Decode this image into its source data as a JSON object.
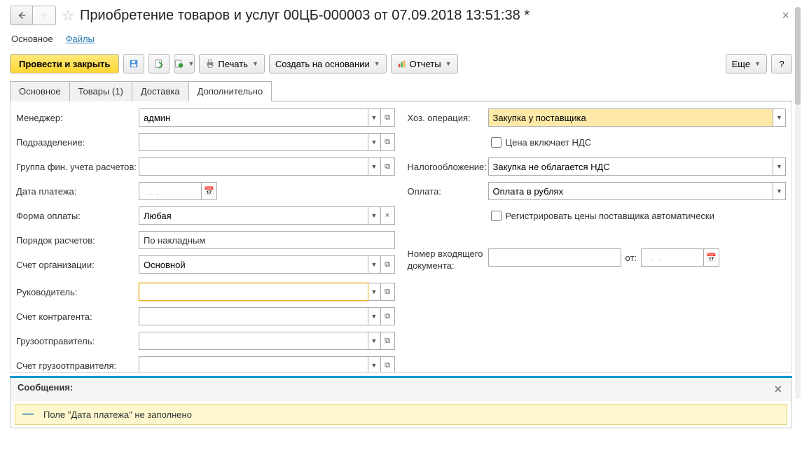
{
  "title": "Приобретение товаров и услуг 00ЦБ-000003 от 07.09.2018 13:51:38 *",
  "topnav": {
    "main": "Основное",
    "files": "Файлы"
  },
  "toolbar": {
    "post_close": "Провести и закрыть",
    "print": "Печать",
    "create_based_on": "Создать на основании",
    "reports": "Отчеты",
    "more": "Еще",
    "help": "?"
  },
  "tabs": {
    "main": "Основное",
    "goods": "Товары (1)",
    "delivery": "Доставка",
    "additional": "Дополнительно"
  },
  "labels": {
    "manager": "Менеджер:",
    "department": "Подразделение:",
    "fin_group": "Группа фин. учета расчетов:",
    "payment_date": "Дата платежа:",
    "payment_form": "Форма оплаты:",
    "settlement_order": "Порядок расчетов:",
    "org_account": "Счет организации:",
    "head": "Руководитель:",
    "counterparty_account": "Счет контрагента:",
    "shipper": "Грузоотправитель:",
    "shipper_account": "Счет грузоотправителя:",
    "business_op": "Хоз. операция:",
    "vat_included": "Цена включает НДС",
    "taxation": "Налогообложение:",
    "payment": "Оплата:",
    "register_prices": "Регистрировать цены поставщика автоматически",
    "incoming_doc": "Номер входящего документа:",
    "from": "от:"
  },
  "values": {
    "manager": "админ",
    "department": "",
    "fin_group": "",
    "payment_date": "  .  .    ",
    "payment_form": "Любая",
    "settlement_order": "По накладным",
    "org_account": "Основной",
    "head": "",
    "counterparty_account": "",
    "shipper": "",
    "shipper_account": "",
    "business_op": "Закупка у поставщика",
    "taxation": "Закупка не облагается НДС",
    "payment": "Оплата в рублях",
    "incoming_doc_no": "",
    "incoming_doc_date": "  .  .    "
  },
  "messages": {
    "header": "Сообщения:",
    "item": "Поле \"Дата платежа\" не заполнено"
  }
}
